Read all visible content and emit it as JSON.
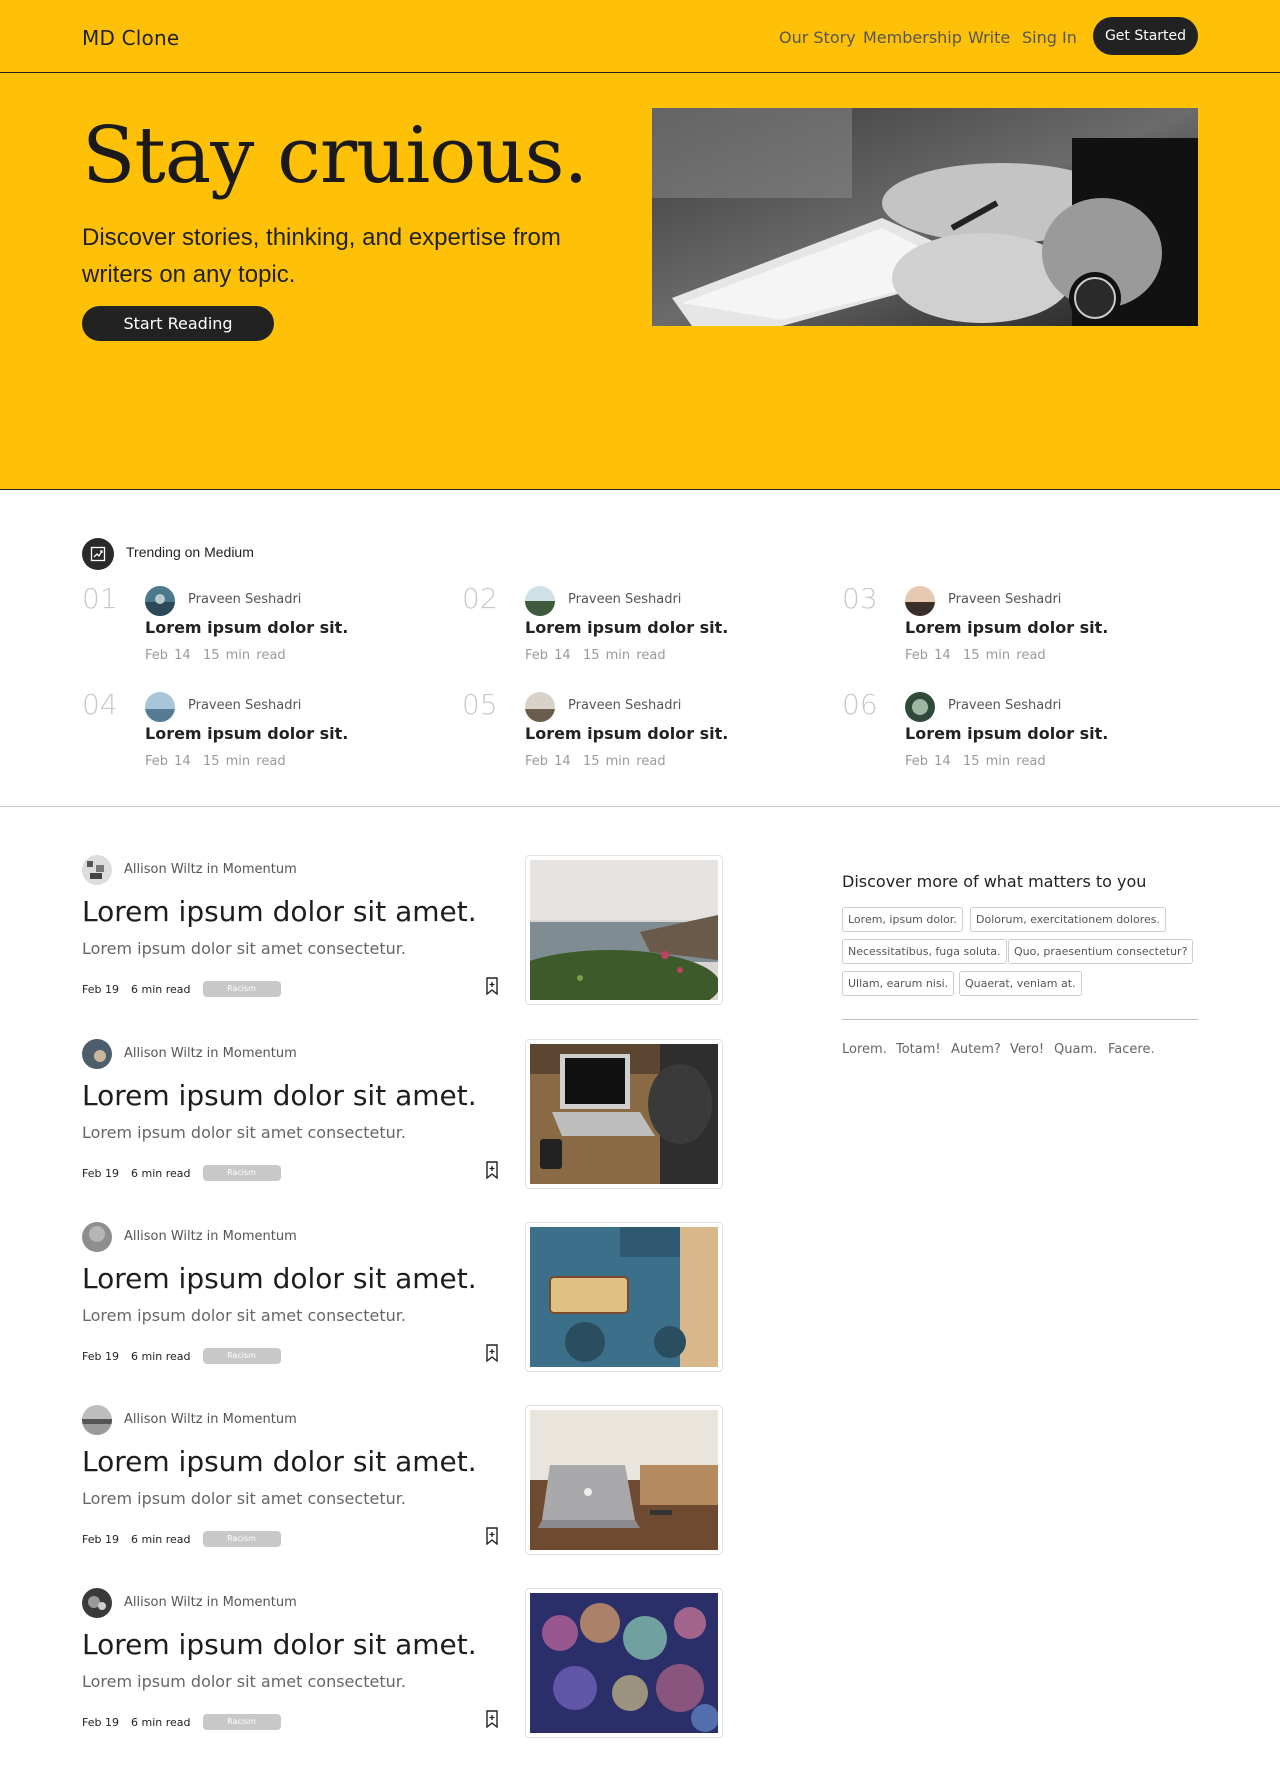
{
  "header": {
    "logo": "MD Clone",
    "nav": [
      "Our Story",
      "Membership",
      "Write",
      "Sing In"
    ],
    "cta": "Get Started"
  },
  "hero": {
    "title": "Stay cruious.",
    "subtitle": "Discover stories, thinking, and expertise from writers on any topic.",
    "button": "Start Reading"
  },
  "trending": {
    "heading": "Trending on Medium",
    "items": [
      {
        "num": "01",
        "author": "Praveen Seshadri",
        "title": "Lorem ipsum dolor sit.",
        "date": "Feb 14",
        "read": "15 min read"
      },
      {
        "num": "02",
        "author": "Praveen Seshadri",
        "title": "Lorem ipsum dolor sit.",
        "date": "Feb 14",
        "read": "15 min read"
      },
      {
        "num": "03",
        "author": "Praveen Seshadri",
        "title": "Lorem ipsum dolor sit.",
        "date": "Feb 14",
        "read": "15 min read"
      },
      {
        "num": "04",
        "author": "Praveen Seshadri",
        "title": "Lorem ipsum dolor sit.",
        "date": "Feb 14",
        "read": "15 min read"
      },
      {
        "num": "05",
        "author": "Praveen Seshadri",
        "title": "Lorem ipsum dolor sit.",
        "date": "Feb 14",
        "read": "15 min read"
      },
      {
        "num": "06",
        "author": "Praveen Seshadri",
        "title": "Lorem ipsum dolor sit.",
        "date": "Feb 14",
        "read": "15 min read"
      }
    ]
  },
  "posts": [
    {
      "author": "Allison Wiltz in Momentum",
      "title": "Lorem ipsum dolor sit amet.",
      "subtitle": "Lorem ipsum dolor sit amet consectetur.",
      "date": "Feb 19",
      "read": "6 min read",
      "tag": "Racism"
    },
    {
      "author": "Allison Wiltz in Momentum",
      "title": "Lorem ipsum dolor sit amet.",
      "subtitle": "Lorem ipsum dolor sit amet consectetur.",
      "date": "Feb 19",
      "read": "6 min read",
      "tag": "Racism"
    },
    {
      "author": "Allison Wiltz in Momentum",
      "title": "Lorem ipsum dolor sit amet.",
      "subtitle": "Lorem ipsum dolor sit amet consectetur.",
      "date": "Feb 19",
      "read": "6 min read",
      "tag": "Racism"
    },
    {
      "author": "Allison Wiltz in Momentum",
      "title": "Lorem ipsum dolor sit amet.",
      "subtitle": "Lorem ipsum dolor sit amet consectetur.",
      "date": "Feb 19",
      "read": "6 min read",
      "tag": "Racism"
    },
    {
      "author": "Allison Wiltz in Momentum",
      "title": "Lorem ipsum dolor sit amet.",
      "subtitle": "Lorem ipsum dolor sit amet consectetur.",
      "date": "Feb 19",
      "read": "6 min read",
      "tag": "Racism"
    }
  ],
  "sidebar": {
    "heading": "Discover more of what matters to you",
    "tags": [
      "Lorem, ipsum dolor.",
      "Dolorum, exercitationem dolores.",
      "Necessitatibus, fuga soluta.",
      "Quo, praesentium consectetur?",
      "Ullam, earum nisi.",
      "Quaerat, veniam at."
    ],
    "links": [
      "Lorem.",
      "Totam!",
      "Autem?",
      "Vero!",
      "Quam.",
      "Facere."
    ]
  },
  "colors": {
    "accent": "#ffc107",
    "dark": "#222222",
    "muted": "#9a9a9a"
  }
}
